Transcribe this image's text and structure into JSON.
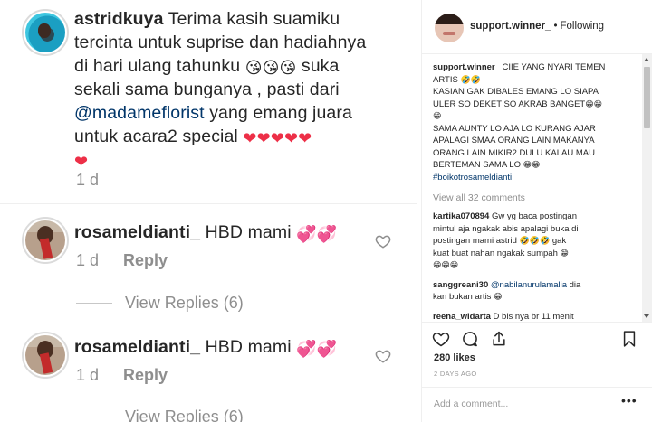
{
  "zoom_comments": {
    "first": {
      "username": "astridkuya",
      "text_1": "Terima kasih suamiku",
      "text_2": "tercinta untuk suprise dan hadiahnya",
      "text_3": "di hari ulang tahunku",
      "text_3_tail": "suka",
      "text_4": "sekali sama bunganya , pasti dari",
      "mention": "@madameflorist",
      "text_5": "yang emang juara",
      "text_6": "untuk acara2 special",
      "time": "1 d"
    },
    "second": {
      "username": "rosameldianti_",
      "text": "HBD mami",
      "time": "1 d",
      "reply": "Reply",
      "view_replies": "View Replies (6)"
    },
    "third": {
      "username": "rosameldianti_",
      "text": "HBD mami",
      "time": "1 d",
      "reply": "Reply",
      "view_replies": "View Replies (6)"
    }
  },
  "post": {
    "header": {
      "username": "support.winner_",
      "dot": "•",
      "follow_status": "Following"
    },
    "caption": {
      "username": "support.winner_",
      "line_1": "CIIE YANG NYARI TEMEN",
      "line_2": "ARTIS",
      "line_3": "KASIAN GAK DIBALES EMANG LO SIAPA",
      "line_4": "ULER SO DEKET SO AKRAB BANGET",
      "line_5": "SAMA AUNTY LO AJA LO KURANG AJAR",
      "line_6": "APALAGI SMAA ORANG LAIN MAKANYA",
      "line_7": "ORANG LAIN MIKIR2 DULU KALAU MAU",
      "line_8": "BERTEMAN SAMA LO",
      "hashtag": "#boikotrosameldianti"
    },
    "view_all": "View all 32 comments",
    "comments": [
      {
        "username": "kartika070894",
        "line_1": "Gw yg baca postingan",
        "line_2": "mintul aja ngakak abis apalagi buka di",
        "line_3": "postingan mami astrid",
        "line_3_tail": "gak",
        "line_4": "kuat buat nahan ngakak sumpah"
      },
      {
        "username": "sanggreani30",
        "mention": "@nabilanurulamalia",
        "line_1": "dia",
        "line_2": "kan bukan artis"
      },
      {
        "username": "reena_widarta",
        "line_1": "D bls nya br 11 menit"
      }
    ],
    "likes": "280 likes",
    "timestamp": "2 DAYS AGO",
    "add_comment_placeholder": "Add a comment...",
    "more_options": "•••"
  },
  "colors": {
    "link": "#003569",
    "heart_red": "#ed2f47",
    "meta_gray": "#8e8e8e",
    "text": "#262626"
  },
  "icons": {
    "kiss_emoji": "😘",
    "laugh_emoji": "🤣",
    "grin_emoji": "😁",
    "hearts_emoji": "💞",
    "heart_emoji": "❤"
  }
}
